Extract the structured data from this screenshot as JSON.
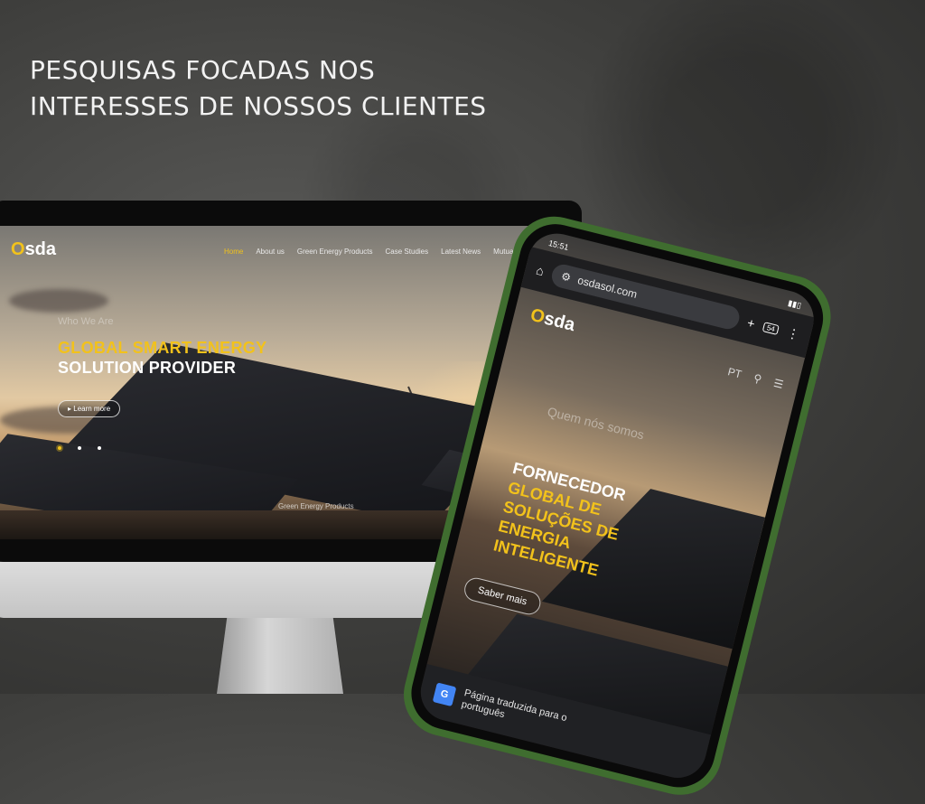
{
  "headline": {
    "line1": "PESQUISAS FOCADAS NOS",
    "line2": "INTERESSES DE NOSSOS CLIENTES"
  },
  "desktop_site": {
    "logo": {
      "o": "O",
      "rest": "sda"
    },
    "nav": [
      "Home",
      "About us",
      "Green Energy Products",
      "Case Studies",
      "Latest News",
      "Mutual Benefiting Partn"
    ],
    "who": "Who We Are",
    "hero_line1": "GLOBAL SMART ENERGY",
    "hero_line2": "SOLUTION PROVIDER",
    "learn_more": "▸ Learn more",
    "section_label": "Green Energy Products"
  },
  "mobile_site": {
    "time": "15:51",
    "url": "osdasol.com",
    "tabs": "54",
    "logo": {
      "o": "O",
      "rest": "sda"
    },
    "lang": "PT",
    "who": "Quem nós somos",
    "hero_line1": "FORNECEDOR",
    "hero_lines": [
      "GLOBAL DE",
      "SOLUÇÕES DE",
      "ENERGIA",
      "INTELIGENTE"
    ],
    "learn_more": "Saber mais",
    "translate_bar": {
      "line1": "Página traduzida para o",
      "line2": "português"
    }
  },
  "colors": {
    "accent": "#f2c21b",
    "background": "#3e3e3c",
    "phone_frame": "#3f6d2f"
  }
}
